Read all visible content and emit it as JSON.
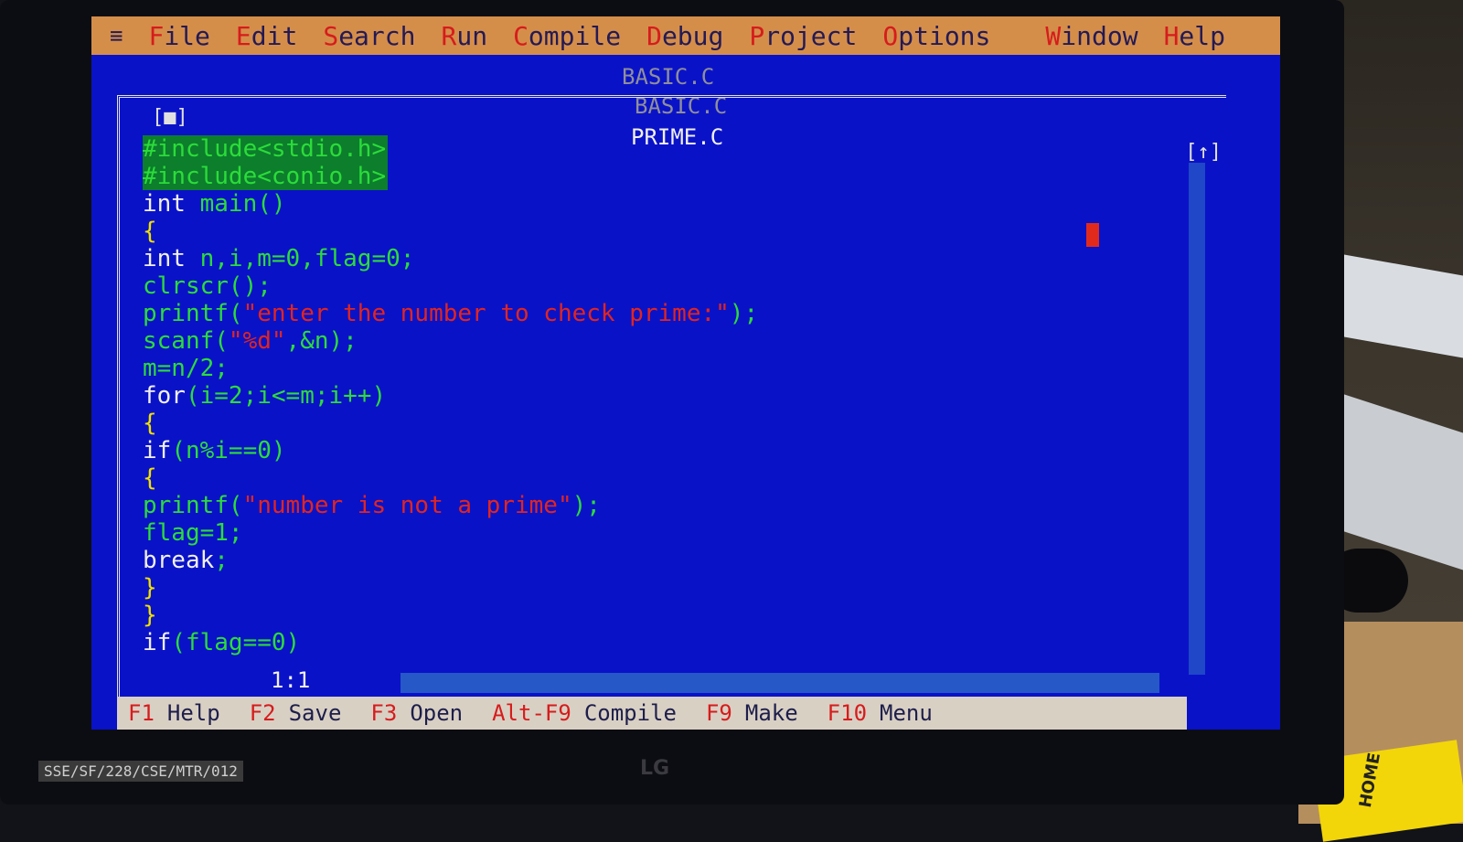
{
  "menu": {
    "system": "≡",
    "items": [
      {
        "hot": "F",
        "rest": "ile"
      },
      {
        "hot": "E",
        "rest": "dit"
      },
      {
        "hot": "S",
        "rest": "earch"
      },
      {
        "hot": "R",
        "rest": "un"
      },
      {
        "hot": "C",
        "rest": "ompile"
      },
      {
        "hot": "D",
        "rest": "ebug"
      },
      {
        "hot": "P",
        "rest": "roject"
      },
      {
        "hot": "O",
        "rest": "ptions"
      },
      {
        "hot": "W",
        "rest": "indow"
      },
      {
        "hot": "H",
        "rest": "elp"
      }
    ]
  },
  "windows": {
    "background_title_1": "BASIC.C",
    "background_title_2": "BASIC.C",
    "active_title": "PRIME.C",
    "close_box": "[■]",
    "zoom_box": "[↑]"
  },
  "editor": {
    "cursor_position": "1:1",
    "lines": [
      [
        {
          "c": "pre",
          "t": "#include<stdio.h>"
        }
      ],
      [
        {
          "c": "pre",
          "t": "#include<conio.h>"
        }
      ],
      [
        {
          "c": "kw",
          "t": "int "
        },
        {
          "c": "id",
          "t": "main()"
        }
      ],
      [
        {
          "c": "brace",
          "t": "{"
        }
      ],
      [
        {
          "c": "kw",
          "t": "int "
        },
        {
          "c": "id",
          "t": "n,i,m=0,flag=0;"
        }
      ],
      [
        {
          "c": "id",
          "t": "clrscr();"
        }
      ],
      [
        {
          "c": "id",
          "t": "printf("
        },
        {
          "c": "str",
          "t": "\"enter the number to check prime:\""
        },
        {
          "c": "id",
          "t": ");"
        }
      ],
      [
        {
          "c": "id",
          "t": "scanf("
        },
        {
          "c": "str",
          "t": "\"%d\""
        },
        {
          "c": "id",
          "t": ",&n);"
        }
      ],
      [
        {
          "c": "id",
          "t": "m=n/2;"
        }
      ],
      [
        {
          "c": "kw",
          "t": "for"
        },
        {
          "c": "id",
          "t": "(i=2;i<=m;i++)"
        }
      ],
      [
        {
          "c": "brace",
          "t": "{"
        }
      ],
      [
        {
          "c": "kw",
          "t": "if"
        },
        {
          "c": "id",
          "t": "(n%i==0)"
        }
      ],
      [
        {
          "c": "brace",
          "t": "{"
        }
      ],
      [
        {
          "c": "id",
          "t": "printf("
        },
        {
          "c": "str",
          "t": "\"number is not a prime\""
        },
        {
          "c": "id",
          "t": ");"
        }
      ],
      [
        {
          "c": "id",
          "t": "flag=1;"
        }
      ],
      [
        {
          "c": "kw",
          "t": "break"
        },
        {
          "c": "id",
          "t": ";"
        }
      ],
      [
        {
          "c": "brace",
          "t": "}"
        }
      ],
      [
        {
          "c": "brace",
          "t": "}"
        }
      ],
      [
        {
          "c": "kw",
          "t": "if"
        },
        {
          "c": "id",
          "t": "(flag==0)"
        }
      ]
    ]
  },
  "status_bar": [
    {
      "key": "F1",
      "label": "Help"
    },
    {
      "key": "F2",
      "label": "Save"
    },
    {
      "key": "F3",
      "label": "Open"
    },
    {
      "key": "Alt-F9",
      "label": "Compile"
    },
    {
      "key": "F9",
      "label": "Make"
    },
    {
      "key": "F10",
      "label": "Menu"
    }
  ],
  "physical": {
    "asset_tag": "SSE/SF/228/CSE/MTR/012",
    "monitor_brand": "LG",
    "sticky_note": "HOME"
  },
  "colors": {
    "screen_bg": "#0a12c8",
    "menu_bg": "#d58e4a",
    "hotkey": "#d61c1c",
    "code_identifier": "#2cdc3a",
    "code_string": "#e1251f",
    "code_keyword": "#f0f0f0"
  }
}
